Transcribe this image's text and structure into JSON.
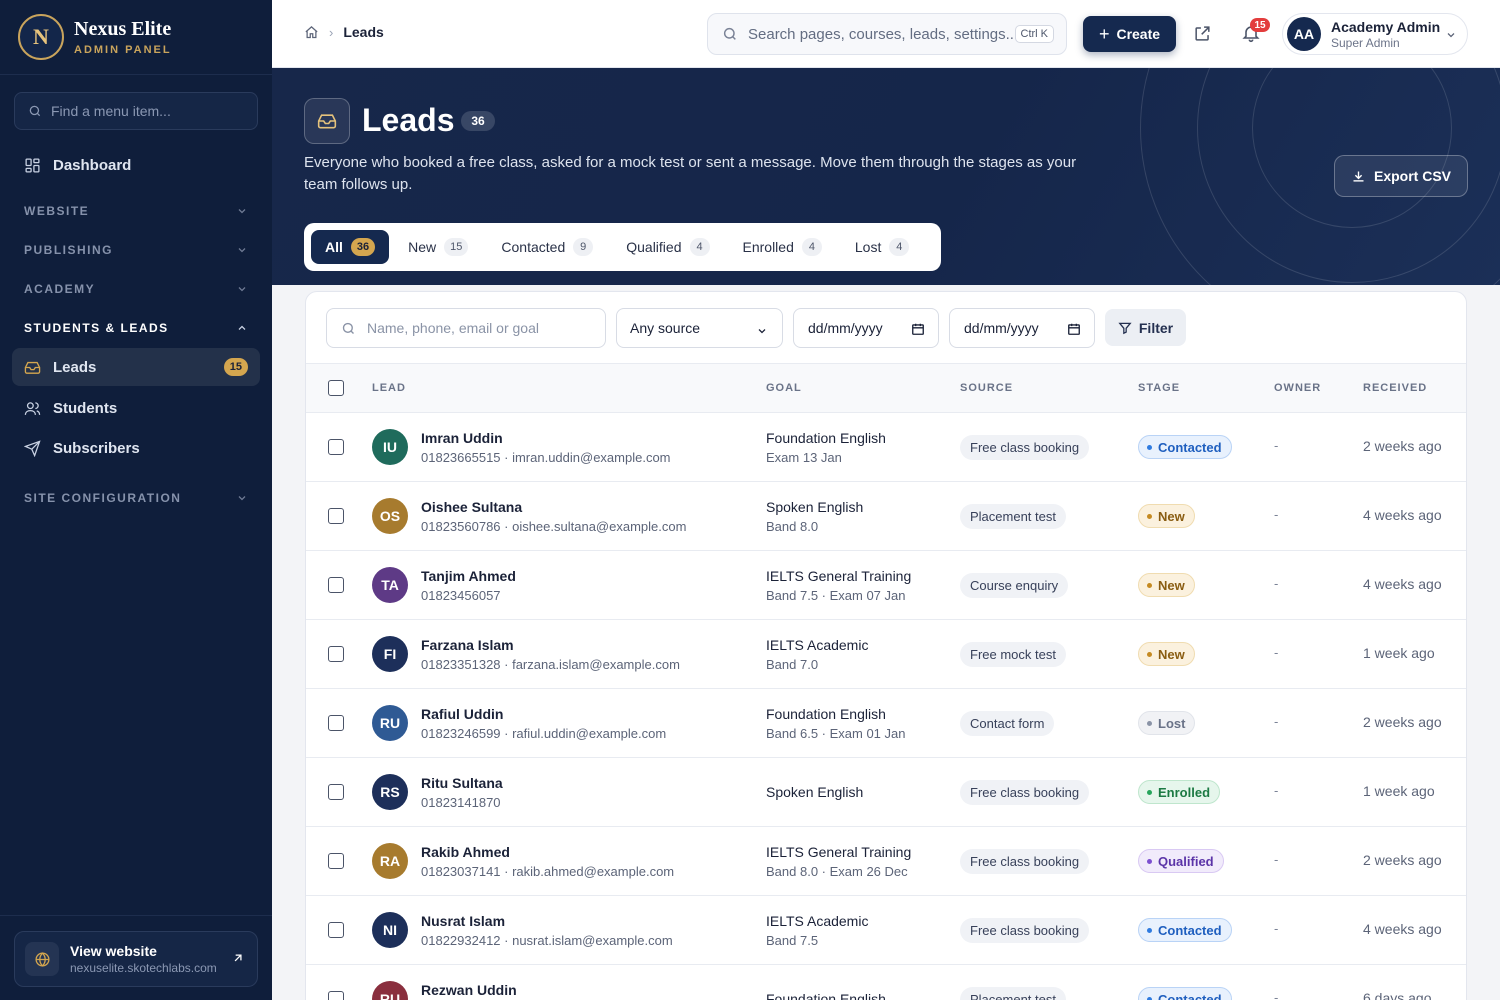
{
  "brand": {
    "logo_letter": "N",
    "name": "Nexus Elite",
    "subtitle": "ADMIN PANEL"
  },
  "sidebar": {
    "search_placeholder": "Find a menu item...",
    "dashboard_label": "Dashboard",
    "sections": [
      {
        "label": "WEBSITE",
        "expanded": false
      },
      {
        "label": "PUBLISHING",
        "expanded": false
      },
      {
        "label": "ACADEMY",
        "expanded": false
      },
      {
        "label": "STUDENTS & LEADS",
        "expanded": true
      },
      {
        "label": "SITE CONFIGURATION",
        "expanded": false
      }
    ],
    "items": [
      {
        "label": "Leads",
        "badge": "15",
        "icon": "inbox-icon",
        "active": true
      },
      {
        "label": "Students",
        "icon": "users-icon"
      },
      {
        "label": "Subscribers",
        "icon": "send-icon"
      }
    ],
    "view_site": {
      "title": "View website",
      "url": "nexuselite.skotechlabs.com"
    }
  },
  "topbar": {
    "breadcrumb_current": "Leads",
    "search_placeholder": "Search pages, courses, leads, settings...",
    "search_shortcut": "Ctrl K",
    "create_label": "Create",
    "notification_count": "15",
    "user": {
      "initials": "AA",
      "name": "Academy Admin",
      "role": "Super Admin"
    }
  },
  "hero": {
    "title": "Leads",
    "count": "36",
    "description": "Everyone who booked a free class, asked for a mock test or sent a message. Move them through the stages as your team follows up.",
    "export_label": "Export CSV",
    "tabs": [
      {
        "label": "All",
        "count": "36",
        "active": true
      },
      {
        "label": "New",
        "count": "15"
      },
      {
        "label": "Contacted",
        "count": "9"
      },
      {
        "label": "Qualified",
        "count": "4"
      },
      {
        "label": "Enrolled",
        "count": "4"
      },
      {
        "label": "Lost",
        "count": "4"
      }
    ]
  },
  "filters": {
    "search_placeholder": "Name, phone, email or goal",
    "source_selected": "Any source",
    "date_from": "dd/mm/yyyy",
    "date_to": "dd/mm/yyyy",
    "filter_label": "Filter"
  },
  "table": {
    "columns": {
      "lead": "LEAD",
      "goal": "GOAL",
      "source": "SOURCE",
      "stage": "STAGE",
      "owner": "OWNER",
      "received": "RECEIVED"
    },
    "stage_colors": {
      "Contacted": {
        "bg": "#e8f1fd",
        "fg": "#1f5fbf",
        "dot": "#2f7be0",
        "border": "#b9d3f6"
      },
      "New": {
        "bg": "#fbf1de",
        "fg": "#8a5d12",
        "dot": "#c58a22",
        "border": "#f0dcb0"
      },
      "Lost": {
        "bg": "#f1f2f5",
        "fg": "#6a7388",
        "dot": "#8a93a6",
        "border": "#e1e4ea"
      },
      "Enrolled": {
        "bg": "#e6f6ec",
        "fg": "#1c7a43",
        "dot": "#27a55b",
        "border": "#bfe6cd"
      },
      "Qualified": {
        "bg": "#f1ebfb",
        "fg": "#5b34a8",
        "dot": "#7c4fd0",
        "border": "#d9c9f3"
      }
    },
    "rows": [
      {
        "initials": "IU",
        "avatar_color": "#1f6b5c",
        "name": "Imran Uddin",
        "contact": "01823665515 · imran.uddin@example.com",
        "goal": "Foundation English",
        "goal_detail": "Exam 13 Jan",
        "source": "Free class booking",
        "stage": "Contacted",
        "owner": "-",
        "received": "2 weeks ago"
      },
      {
        "initials": "OS",
        "avatar_color": "#a77b2e",
        "name": "Oishee Sultana",
        "contact": "01823560786 · oishee.sultana@example.com",
        "goal": "Spoken English",
        "goal_detail": "Band 8.0",
        "source": "Placement test",
        "stage": "New",
        "owner": "-",
        "received": "4 weeks ago"
      },
      {
        "initials": "TA",
        "avatar_color": "#5e3a86",
        "name": "Tanjim Ahmed",
        "contact": "01823456057",
        "goal": "IELTS General Training",
        "goal_detail": "Band 7.5 · Exam 07 Jan",
        "source": "Course enquiry",
        "stage": "New",
        "owner": "-",
        "received": "4 weeks ago"
      },
      {
        "initials": "FI",
        "avatar_color": "#1d2f5a",
        "name": "Farzana Islam",
        "contact": "01823351328 · farzana.islam@example.com",
        "goal": "IELTS Academic",
        "goal_detail": "Band 7.0",
        "source": "Free mock test",
        "stage": "New",
        "owner": "-",
        "received": "1 week ago"
      },
      {
        "initials": "RU",
        "avatar_color": "#2f5a94",
        "name": "Rafiul Uddin",
        "contact": "01823246599 · rafiul.uddin@example.com",
        "goal": "Foundation English",
        "goal_detail": "Band 6.5 · Exam 01 Jan",
        "source": "Contact form",
        "stage": "Lost",
        "owner": "-",
        "received": "2 weeks ago"
      },
      {
        "initials": "RS",
        "avatar_color": "#1d2f5a",
        "name": "Ritu Sultana",
        "contact": "01823141870",
        "goal": "Spoken English",
        "goal_detail": "",
        "source": "Free class booking",
        "stage": "Enrolled",
        "owner": "-",
        "received": "1 week ago"
      },
      {
        "initials": "RA",
        "avatar_color": "#a77b2e",
        "name": "Rakib Ahmed",
        "contact": "01823037141 · rakib.ahmed@example.com",
        "goal": "IELTS General Training",
        "goal_detail": "Band 8.0 · Exam 26 Dec",
        "source": "Free class booking",
        "stage": "Qualified",
        "owner": "-",
        "received": "2 weeks ago"
      },
      {
        "initials": "NI",
        "avatar_color": "#1d2f5a",
        "name": "Nusrat Islam",
        "contact": "01822932412 · nusrat.islam@example.com",
        "goal": "IELTS Academic",
        "goal_detail": "Band 7.5",
        "source": "Free class booking",
        "stage": "Contacted",
        "owner": "-",
        "received": "4 weeks ago"
      },
      {
        "initials": "RU",
        "avatar_color": "#8a2f3e",
        "name": "Rezwan Uddin",
        "contact": "",
        "goal": "Foundation English",
        "goal_detail": "",
        "source": "Placement test",
        "stage": "Contacted",
        "owner": "-",
        "received": "6 days ago"
      }
    ]
  }
}
